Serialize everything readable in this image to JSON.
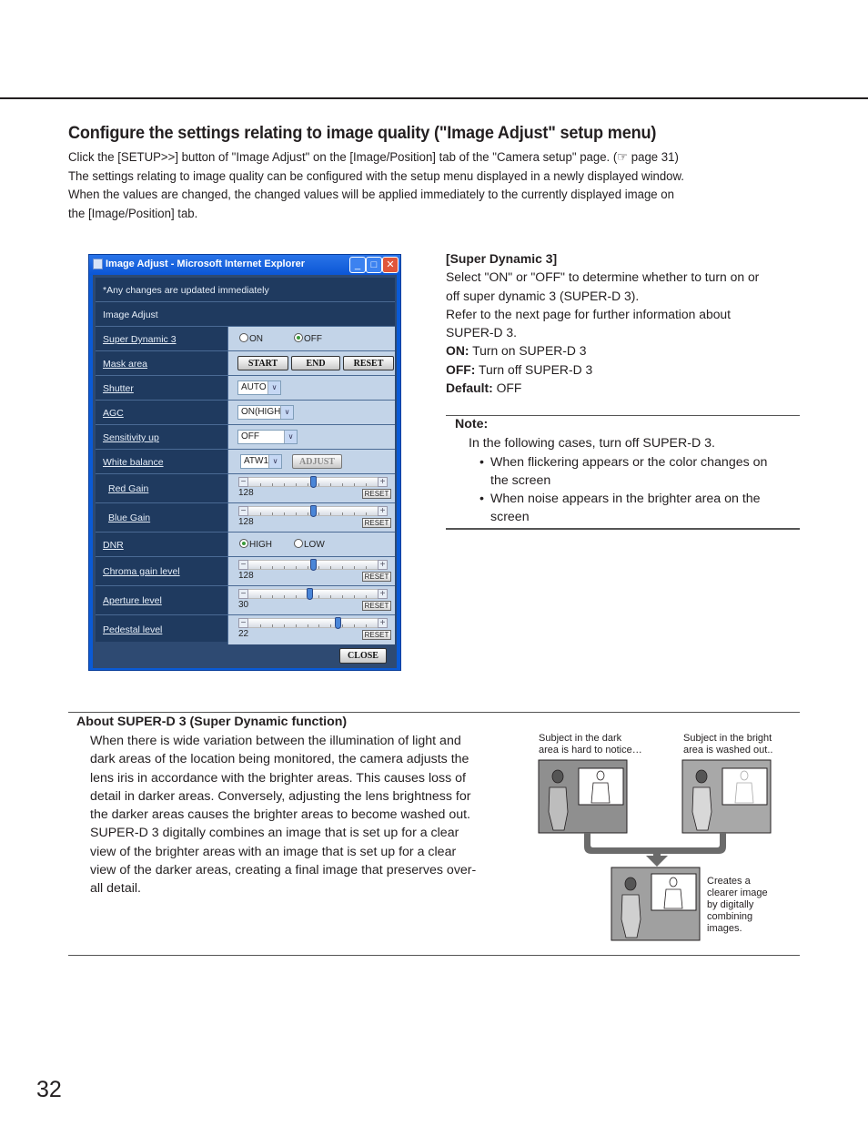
{
  "heading": "Configure the settings relating to image quality (\"Image Adjust\" setup menu)",
  "intro": [
    "Click the [SETUP>>] button of \"Image Adjust\" on the [Image/Position] tab of the \"Camera setup\" page. (☞ page 31)",
    "The settings relating to image quality can be configured with the setup menu displayed in a newly displayed window.",
    "When the values are changed, the changed values will be applied immediately to the currently displayed image on",
    "the [Image/Position] tab."
  ],
  "window": {
    "title": "Image Adjust - Microsoft Internet Explorer",
    "notice": "*Any changes are updated immediately",
    "section": "Image Adjust",
    "super_dynamic": {
      "label": "Super Dynamic 3",
      "on": "ON",
      "off": "OFF",
      "selected": "OFF"
    },
    "mask_area": {
      "label": "Mask area",
      "start": "START",
      "end": "END",
      "reset": "RESET"
    },
    "shutter": {
      "label": "Shutter",
      "value": "AUTO"
    },
    "agc": {
      "label": "AGC",
      "value": "ON(HIGH)"
    },
    "sensitivity_up": {
      "label": "Sensitivity up",
      "value": "OFF"
    },
    "white_balance": {
      "label": "White balance",
      "value": "ATW1",
      "adjust": "ADJUST"
    },
    "red_gain": {
      "label": "Red Gain",
      "value": "128",
      "position": 0.5,
      "reset": "RESET"
    },
    "blue_gain": {
      "label": "Blue Gain",
      "value": "128",
      "position": 0.5,
      "reset": "RESET"
    },
    "dnr": {
      "label": "DNR",
      "high": "HIGH",
      "low": "LOW",
      "selected": "HIGH"
    },
    "chroma_gain": {
      "label": "Chroma gain level",
      "value": "128",
      "position": 0.5,
      "reset": "RESET"
    },
    "aperture": {
      "label": "Aperture level",
      "value": "30",
      "position": 0.47,
      "reset": "RESET"
    },
    "pedestal": {
      "label": "Pedestal level",
      "value": "22",
      "position": 0.69,
      "reset": "RESET"
    },
    "close": "CLOSE"
  },
  "super_dynamic_desc": {
    "title": "[Super Dynamic 3]",
    "lines": [
      "Select \"ON\" or \"OFF\" to determine whether to turn on or",
      "off super dynamic 3 (SUPER-D 3).",
      "Refer to the next page for further information about",
      "SUPER-D 3."
    ],
    "on_label": "ON:",
    "on_text": " Turn on SUPER-D 3",
    "off_label": "OFF:",
    "off_text": " Turn off SUPER-D 3",
    "default_label": "Default:",
    "default_text": " OFF"
  },
  "note": {
    "title": "Note:",
    "lead": "In the following cases, turn off SUPER-D 3.",
    "bullets": [
      {
        "line1": "When flickering appears or the color changes on",
        "line2": "the screen"
      },
      {
        "line1": "When noise appears in the brighter area on the",
        "line2": "screen"
      }
    ]
  },
  "about": {
    "title": "About SUPER-D 3 (Super Dynamic function)",
    "lines": [
      "When there is wide variation between the illumination of light and",
      "dark areas of the location being monitored, the camera adjusts the",
      "lens iris in accordance with the brighter areas. This causes loss of",
      "detail in darker areas. Conversely, adjusting the lens brightness for",
      "the darker areas causes the brighter areas to become washed out.",
      "SUPER-D 3 digitally combines an image that is set up for a clear",
      "view of the brighter areas with an image that is set up for a clear",
      "view of the darker areas, creating a final image that preserves over-",
      "all detail."
    ]
  },
  "illustration": {
    "dark_caption": [
      "Subject in the dark",
      "area is hard to notice…"
    ],
    "bright_caption": [
      "Subject in the bright",
      "area is washed out.."
    ],
    "result_caption": [
      "Creates a",
      "clearer image",
      "by digitally",
      "combining",
      "images."
    ]
  },
  "page_number": "32"
}
